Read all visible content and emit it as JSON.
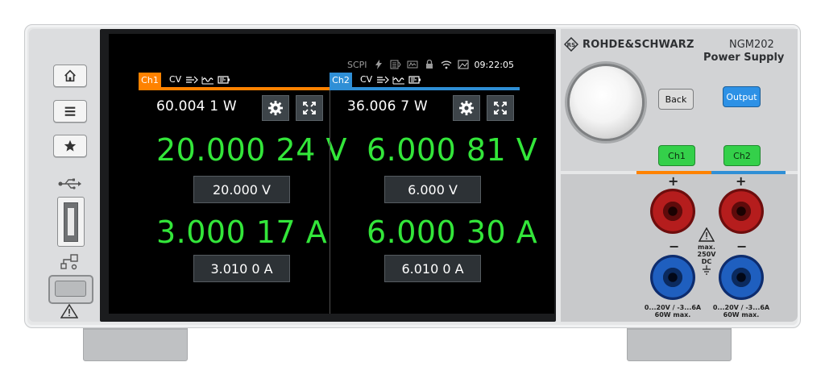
{
  "device": {
    "brand": "ROHDE&SCHWARZ",
    "model": "NGM202",
    "subtitle": "Power Supply"
  },
  "statusbar": {
    "scpi": "SCPI",
    "time": "09:22:05"
  },
  "channels": [
    {
      "tag": "Ch1",
      "mode": "CV",
      "power": "60.004 1 W",
      "voltage": "20.000 24 V",
      "voltage_set": "20.000   V",
      "current": "3.000 17 A",
      "current_set": "3.010 0   A",
      "color": "#ff8200"
    },
    {
      "tag": "Ch2",
      "mode": "CV",
      "power": "36.006 7 W",
      "voltage": "6.000 81 V",
      "voltage_set": "6.000    V",
      "current": "6.000 30 A",
      "current_set": "6.010 0   A",
      "color": "#2f8fd6"
    }
  ],
  "keys": {
    "back": "Back",
    "output": "Output",
    "ch1": "Ch1",
    "ch2": "Ch2"
  },
  "terminals": {
    "plus": "+",
    "minus": "−",
    "max_label": "max.",
    "max_voltage": "250V DC",
    "rating_line1": "0...20V / -3...6A",
    "rating_line2": "60W max."
  },
  "colors": {
    "reading_green": "#33e63a",
    "output_blue": "#2d91e6",
    "channel_key_green": "#34d04a"
  },
  "icons": [
    "home-icon",
    "menu-icon",
    "star-icon",
    "usb-icon",
    "network-icon",
    "warning-icon",
    "gear-icon",
    "expand-icon",
    "lightning-icon",
    "wifi-icon"
  ]
}
